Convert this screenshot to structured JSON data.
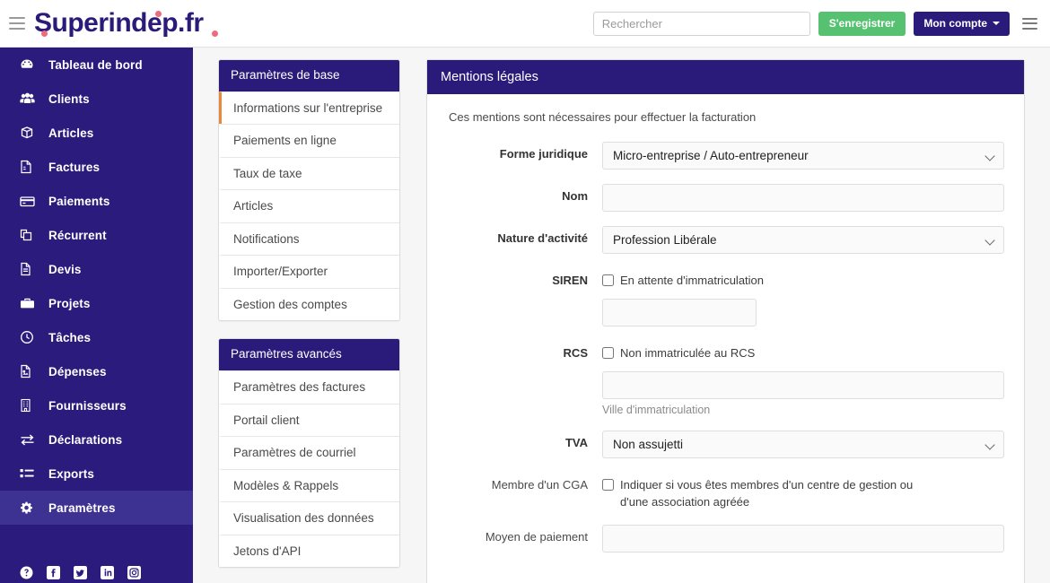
{
  "header": {
    "menu_icon": "hamburger-icon",
    "logo_text": "Superindep.fr",
    "search_placeholder": "Rechercher",
    "search_value": "",
    "register_label": "S'enregistrer",
    "account_label": "Mon compte",
    "right_menu_icon": "hamburger-icon"
  },
  "sidebar": {
    "active": "Paramètres",
    "items": [
      {
        "label": "Tableau de bord",
        "icon": "dashboard-icon"
      },
      {
        "label": "Clients",
        "icon": "users-icon"
      },
      {
        "label": "Articles",
        "icon": "box-icon"
      },
      {
        "label": "Factures",
        "icon": "file-invoice-icon"
      },
      {
        "label": "Paiements",
        "icon": "credit-card-icon"
      },
      {
        "label": "Récurrent",
        "icon": "copy-icon"
      },
      {
        "label": "Devis",
        "icon": "file-icon"
      },
      {
        "label": "Projets",
        "icon": "briefcase-icon"
      },
      {
        "label": "Tâches",
        "icon": "clock-icon"
      },
      {
        "label": "Dépenses",
        "icon": "file-image-icon"
      },
      {
        "label": "Fournisseurs",
        "icon": "building-icon"
      },
      {
        "label": "Déclarations",
        "icon": "exchange-icon"
      },
      {
        "label": "Exports",
        "icon": "list-icon"
      },
      {
        "label": "Paramètres",
        "icon": "gear-icon"
      }
    ],
    "social": [
      {
        "name": "help-icon",
        "glyph": "?"
      },
      {
        "name": "facebook-icon",
        "glyph": "f"
      },
      {
        "name": "twitter-icon",
        "glyph": "t"
      },
      {
        "name": "linkedin-icon",
        "glyph": "in"
      },
      {
        "name": "instagram-icon",
        "glyph": "ig"
      }
    ]
  },
  "settings_menu": {
    "basic": {
      "title": "Paramètres de base",
      "items": [
        {
          "label": "Informations sur l'entreprise",
          "active": true
        },
        {
          "label": "Paiements en ligne",
          "active": false
        },
        {
          "label": "Taux de taxe",
          "active": false
        },
        {
          "label": "Articles",
          "active": false
        },
        {
          "label": "Notifications",
          "active": false
        },
        {
          "label": "Importer/Exporter",
          "active": false
        },
        {
          "label": "Gestion des comptes",
          "active": false
        }
      ]
    },
    "advanced": {
      "title": "Paramètres avancés",
      "items": [
        {
          "label": "Paramètres des factures",
          "active": false
        },
        {
          "label": "Portail client",
          "active": false
        },
        {
          "label": "Paramètres de courriel",
          "active": false
        },
        {
          "label": "Modèles & Rappels",
          "active": false
        },
        {
          "label": "Visualisation des données",
          "active": false
        },
        {
          "label": "Jetons d'API",
          "active": false
        }
      ]
    }
  },
  "main": {
    "card_title": "Mentions légales",
    "intro": "Ces mentions sont nécessaires pour effectuer la facturation",
    "fields": {
      "forme_juridique_label": "Forme juridique",
      "forme_juridique_value": "Micro-entreprise / Auto-entrepreneur",
      "nom_label": "Nom",
      "nom_value": "",
      "nature_label": "Nature d'activité",
      "nature_value": "Profession Libérale",
      "siren_label": "SIREN",
      "siren_checkbox_label": "En attente d'immatriculation",
      "siren_checked": false,
      "siren_value": "",
      "rcs_label": "RCS",
      "rcs_checkbox_label": "Non immatriculée au RCS",
      "rcs_checked": false,
      "rcs_value": "",
      "rcs_helper": "Ville d'immatriculation",
      "tva_label": "TVA",
      "tva_value": "Non assujetti",
      "cga_label": "Membre d'un CGA",
      "cga_checkbox_label": "Indiquer si vous êtes membres d'un centre de gestion ou d'une association agréée",
      "cga_checked": false,
      "moyen_label": "Moyen de paiement",
      "moyen_value": ""
    }
  },
  "colors": {
    "brand_navy": "#2a1b7a",
    "sidebar_navy": "#2b1b7c",
    "sidebar_active": "#3d3191",
    "accent_pink": "#f06a7e",
    "accent_orange": "#e8883a",
    "green": "#56c271"
  }
}
